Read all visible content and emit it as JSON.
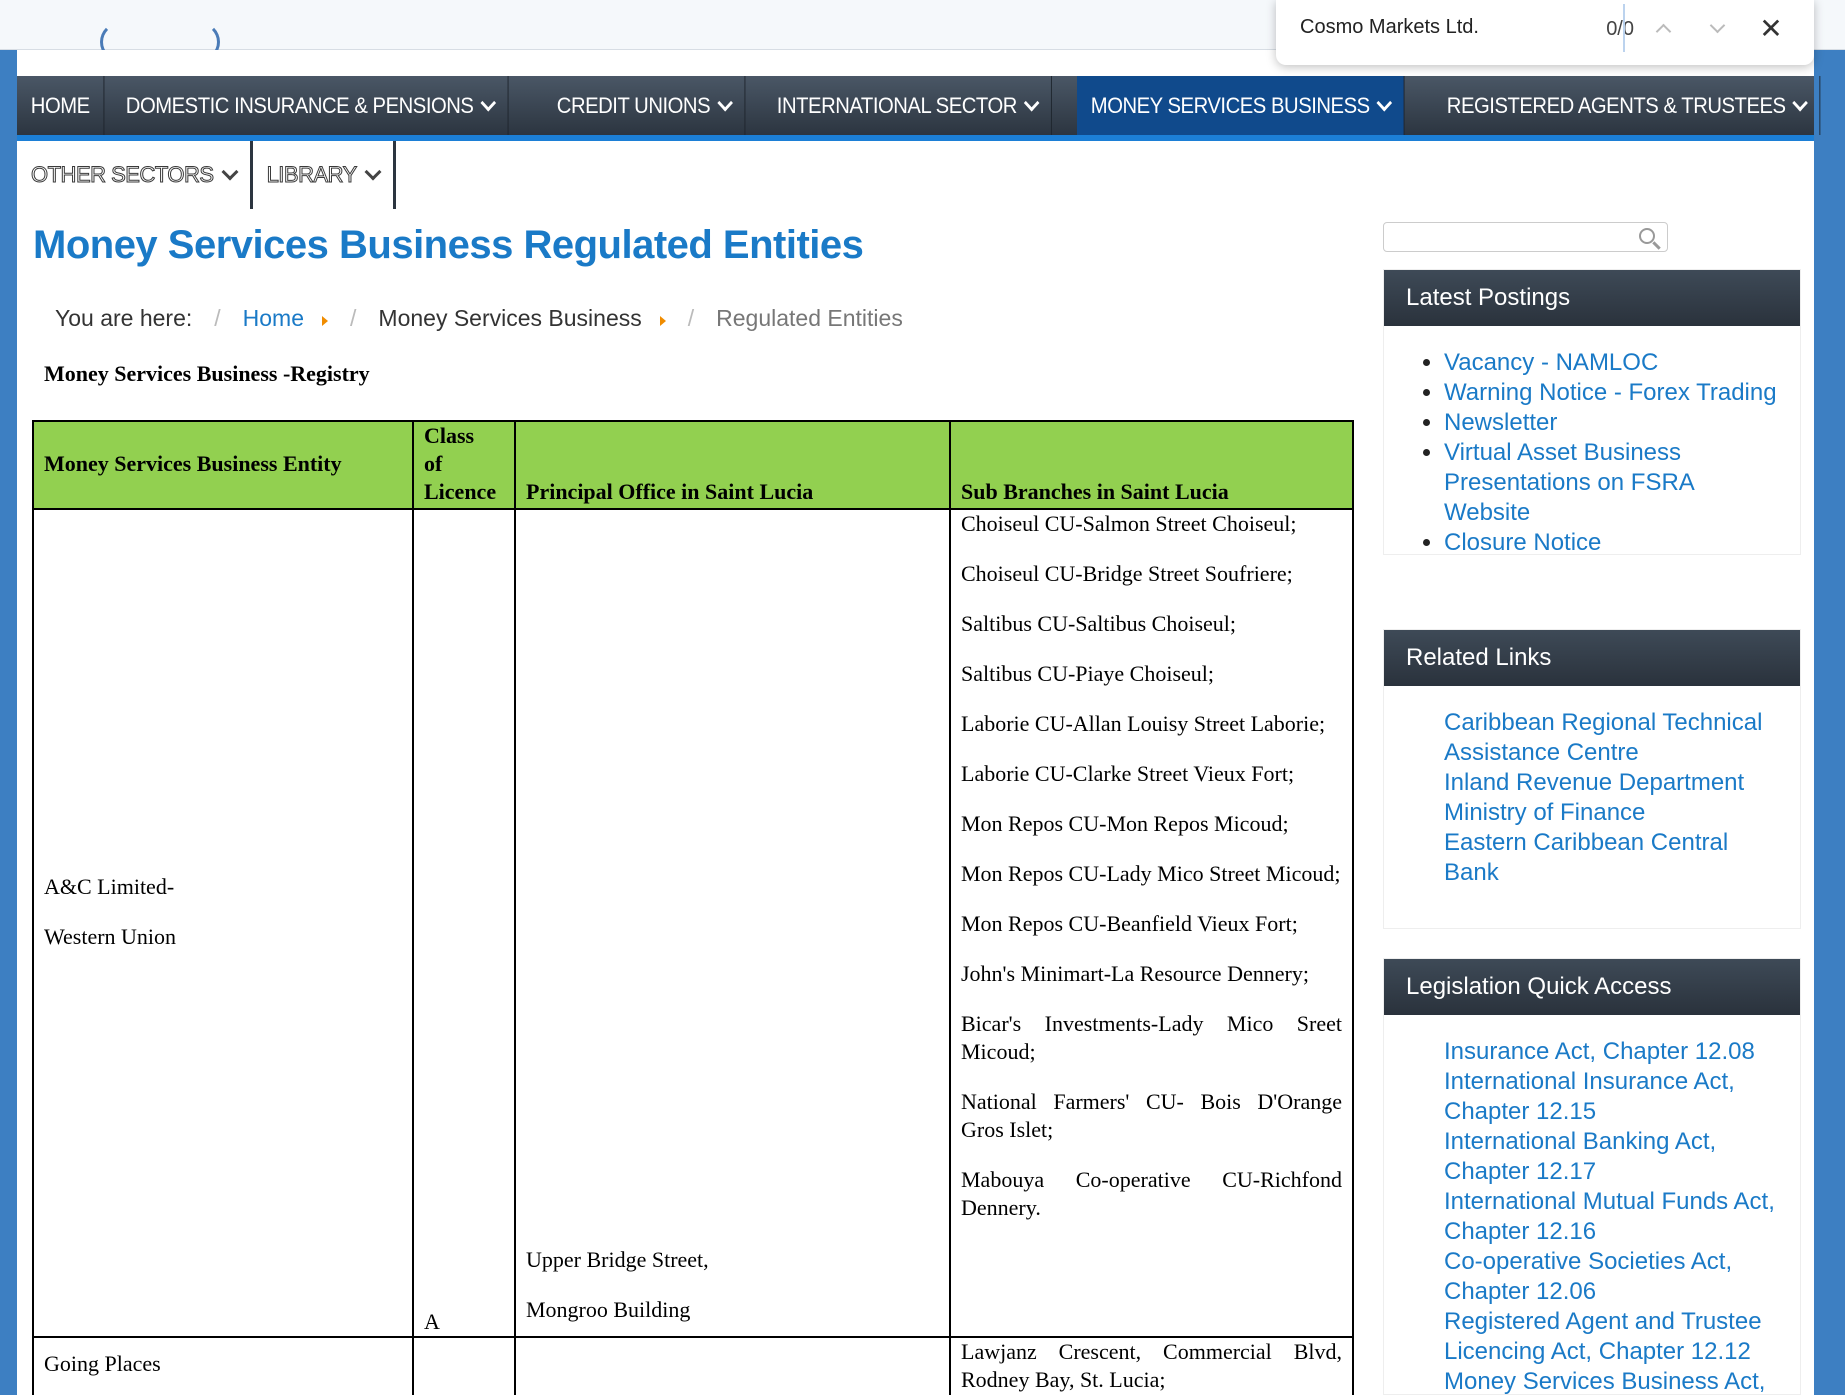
{
  "find_bar": {
    "query": "Cosmo Markets Ltd.",
    "count": "0/0",
    "close_symbol": "✕"
  },
  "nav": {
    "main": [
      {
        "label": "HOME"
      },
      {
        "label": "DOMESTIC INSURANCE & PENSIONS"
      },
      {
        "label": "CREDIT UNIONS"
      },
      {
        "label": "INTERNATIONAL SECTOR"
      },
      {
        "label": "MONEY SERVICES BUSINESS"
      },
      {
        "label": "REGISTERED AGENTS & TRUSTEES"
      }
    ],
    "sub": [
      {
        "label": "OTHER SECTORS"
      },
      {
        "label": "LIBRARY"
      }
    ]
  },
  "page": {
    "title": "Money Services Business Regulated Entities",
    "breadcrumb": {
      "prefix": "You are here:",
      "separator": "/",
      "home": "Home",
      "section": "Money Services Business",
      "current": "Regulated Entities"
    },
    "registry_heading": "Money Services Business -Registry"
  },
  "table": {
    "headers": {
      "entity": "Money Services Business Entity",
      "class_line1": "Class",
      "class_line2": "of",
      "class_line3": "Licence",
      "office": "Principal Office in Saint Lucia",
      "branches": "Sub Branches in Saint Lucia"
    },
    "rows": [
      {
        "entity_line1": "A&C Limited-",
        "entity_line2": "Western Union",
        "class": "A",
        "office_line1": "Upper Bridge Street,",
        "office_line2": "Mongroo Building",
        "branches": [
          "Choiseul CU-Salmon Street Choiseul;",
          "Choiseul CU-Bridge Street Soufriere;",
          "Saltibus CU-Saltibus Choiseul;",
          "Saltibus CU-Piaye Choiseul;",
          "Laborie CU-Allan Louisy Street Laborie;",
          "Laborie CU-Clarke Street Vieux Fort;",
          "Mon Repos CU-Mon Repos Micoud;",
          "Mon Repos CU-Lady Mico Street Micoud;",
          "Mon Repos CU-Beanfield Vieux Fort;",
          "John's Minimart-La Resource Dennery;",
          "Bicar's Investments-Lady Mico Sreet Micoud;",
          "National Farmers' CU- Bois D'Orange Gros Islet;",
          "Mabouya Co-operative CU-Richfond Dennery."
        ]
      },
      {
        "entity_line1": "Going Places",
        "branch_first": "Lawjanz Crescent, Commercial Blvd, Rodney Bay, St. Lucia;"
      }
    ]
  },
  "sidebar": {
    "latest": {
      "title": "Latest Postings",
      "items": [
        "Vacancy - NAMLOC",
        "Warning Notice - Forex Trading",
        "Newsletter",
        "Virtual Asset Business Presentations on FSRA Website",
        "Closure Notice"
      ]
    },
    "related": {
      "title": "Related Links",
      "items": [
        "Caribbean Regional Technical Assistance Centre",
        "Inland Revenue Department",
        "Ministry of Finance",
        "Eastern Caribbean Central Bank"
      ]
    },
    "legislation": {
      "title": "Legislation Quick Access",
      "items": [
        "Insurance Act, Chapter 12.08",
        "International Insurance Act, Chapter 12.15",
        "International Banking Act, Chapter 12.17",
        "International Mutual Funds Act, Chapter 12.16",
        "Co-operative Societies Act, Chapter 12.06",
        "Registered Agent and Trustee Licencing Act, Chapter 12.12",
        "Money Services Business Act,"
      ]
    }
  }
}
